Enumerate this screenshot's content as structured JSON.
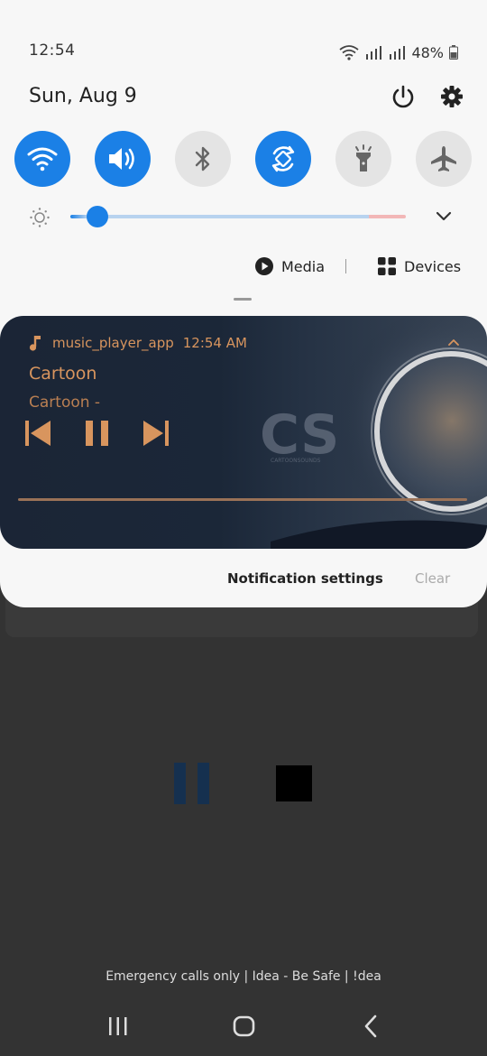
{
  "status_bar": {
    "time": "12:54",
    "battery": "48%"
  },
  "header": {
    "date": "Sun, Aug 9",
    "icons": [
      "power-icon",
      "settings-gear-icon"
    ]
  },
  "quick_settings": {
    "tiles": [
      {
        "icon": "wifi-icon",
        "state": "on"
      },
      {
        "icon": "sound-icon",
        "state": "on"
      },
      {
        "icon": "bluetooth-icon",
        "state": "off"
      },
      {
        "icon": "auto-rotate-icon",
        "state": "on"
      },
      {
        "icon": "flashlight-icon",
        "state": "off"
      },
      {
        "icon": "airplane-mode-icon",
        "state": "off"
      }
    ],
    "brightness_level": 0.08,
    "accent_color": "#1b80e6"
  },
  "media_row": {
    "media_label": "Media",
    "devices_label": "Devices"
  },
  "media_card": {
    "app_name": "music_player_app",
    "time": "12:54 AM",
    "title": "Cartoon",
    "artist": "Cartoon -",
    "accent_color": "#d8955e",
    "art_watermark": "CS",
    "art_caption": "CARTOONSOUNDS"
  },
  "notification_footer": {
    "settings_label": "Notification settings",
    "clear_label": "Clear"
  },
  "lock_footer": {
    "emergency_text": "Emergency calls only | Idea - Be Safe | !dea"
  }
}
